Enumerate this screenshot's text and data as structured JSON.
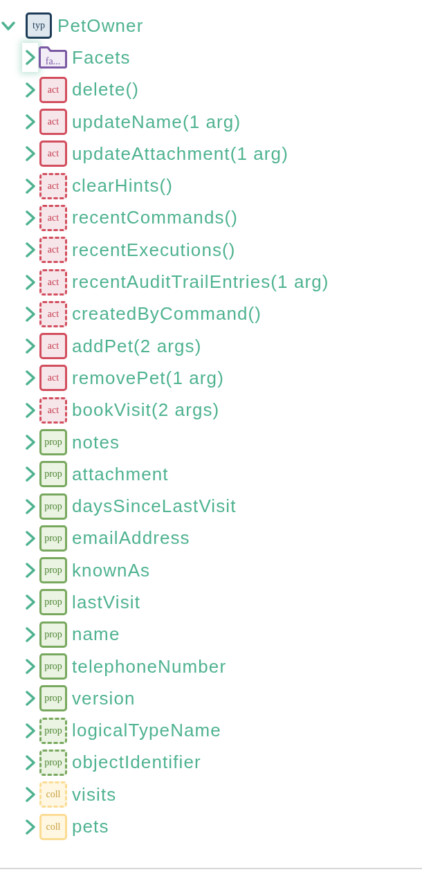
{
  "tree": {
    "label": "PetOwner",
    "badge": "typ",
    "kind": "type",
    "dashed": false,
    "expanded": true,
    "focused": false,
    "children": [
      {
        "label": "Facets",
        "badge": "fa...",
        "kind": "folder",
        "dashed": false,
        "expanded": false,
        "focused": true
      },
      {
        "label": "delete()",
        "badge": "act",
        "kind": "action",
        "dashed": false,
        "expanded": false,
        "focused": false
      },
      {
        "label": "updateName(1 arg)",
        "badge": "act",
        "kind": "action",
        "dashed": false,
        "expanded": false,
        "focused": false
      },
      {
        "label": "updateAttachment(1 arg)",
        "badge": "act",
        "kind": "action",
        "dashed": false,
        "expanded": false,
        "focused": false
      },
      {
        "label": "clearHints()",
        "badge": "act",
        "kind": "action",
        "dashed": true,
        "expanded": false,
        "focused": false
      },
      {
        "label": "recentCommands()",
        "badge": "act",
        "kind": "action",
        "dashed": true,
        "expanded": false,
        "focused": false
      },
      {
        "label": "recentExecutions()",
        "badge": "act",
        "kind": "action",
        "dashed": true,
        "expanded": false,
        "focused": false
      },
      {
        "label": "recentAuditTrailEntries(1 arg)",
        "badge": "act",
        "kind": "action",
        "dashed": true,
        "expanded": false,
        "focused": false
      },
      {
        "label": "createdByCommand()",
        "badge": "act",
        "kind": "action",
        "dashed": true,
        "expanded": false,
        "focused": false
      },
      {
        "label": "addPet(2 args)",
        "badge": "act",
        "kind": "action",
        "dashed": false,
        "expanded": false,
        "focused": false
      },
      {
        "label": "removePet(1 arg)",
        "badge": "act",
        "kind": "action",
        "dashed": false,
        "expanded": false,
        "focused": false
      },
      {
        "label": "bookVisit(2 args)",
        "badge": "act",
        "kind": "action",
        "dashed": true,
        "expanded": false,
        "focused": false
      },
      {
        "label": "notes",
        "badge": "prop",
        "kind": "property",
        "dashed": false,
        "expanded": false,
        "focused": false
      },
      {
        "label": "attachment",
        "badge": "prop",
        "kind": "property",
        "dashed": false,
        "expanded": false,
        "focused": false
      },
      {
        "label": "daysSinceLastVisit",
        "badge": "prop",
        "kind": "property",
        "dashed": false,
        "expanded": false,
        "focused": false
      },
      {
        "label": "emailAddress",
        "badge": "prop",
        "kind": "property",
        "dashed": false,
        "expanded": false,
        "focused": false
      },
      {
        "label": "knownAs",
        "badge": "prop",
        "kind": "property",
        "dashed": false,
        "expanded": false,
        "focused": false
      },
      {
        "label": "lastVisit",
        "badge": "prop",
        "kind": "property",
        "dashed": false,
        "expanded": false,
        "focused": false
      },
      {
        "label": "name",
        "badge": "prop",
        "kind": "property",
        "dashed": false,
        "expanded": false,
        "focused": false
      },
      {
        "label": "telephoneNumber",
        "badge": "prop",
        "kind": "property",
        "dashed": false,
        "expanded": false,
        "focused": false
      },
      {
        "label": "version",
        "badge": "prop",
        "kind": "property",
        "dashed": false,
        "expanded": false,
        "focused": false
      },
      {
        "label": "logicalTypeName",
        "badge": "prop",
        "kind": "property",
        "dashed": true,
        "expanded": false,
        "focused": false
      },
      {
        "label": "objectIdentifier",
        "badge": "prop",
        "kind": "property",
        "dashed": true,
        "expanded": false,
        "focused": false
      },
      {
        "label": "visits",
        "badge": "coll",
        "kind": "collection",
        "dashed": true,
        "expanded": false,
        "focused": false
      },
      {
        "label": "pets",
        "badge": "coll",
        "kind": "collection",
        "dashed": false,
        "expanded": false,
        "focused": false
      }
    ]
  }
}
